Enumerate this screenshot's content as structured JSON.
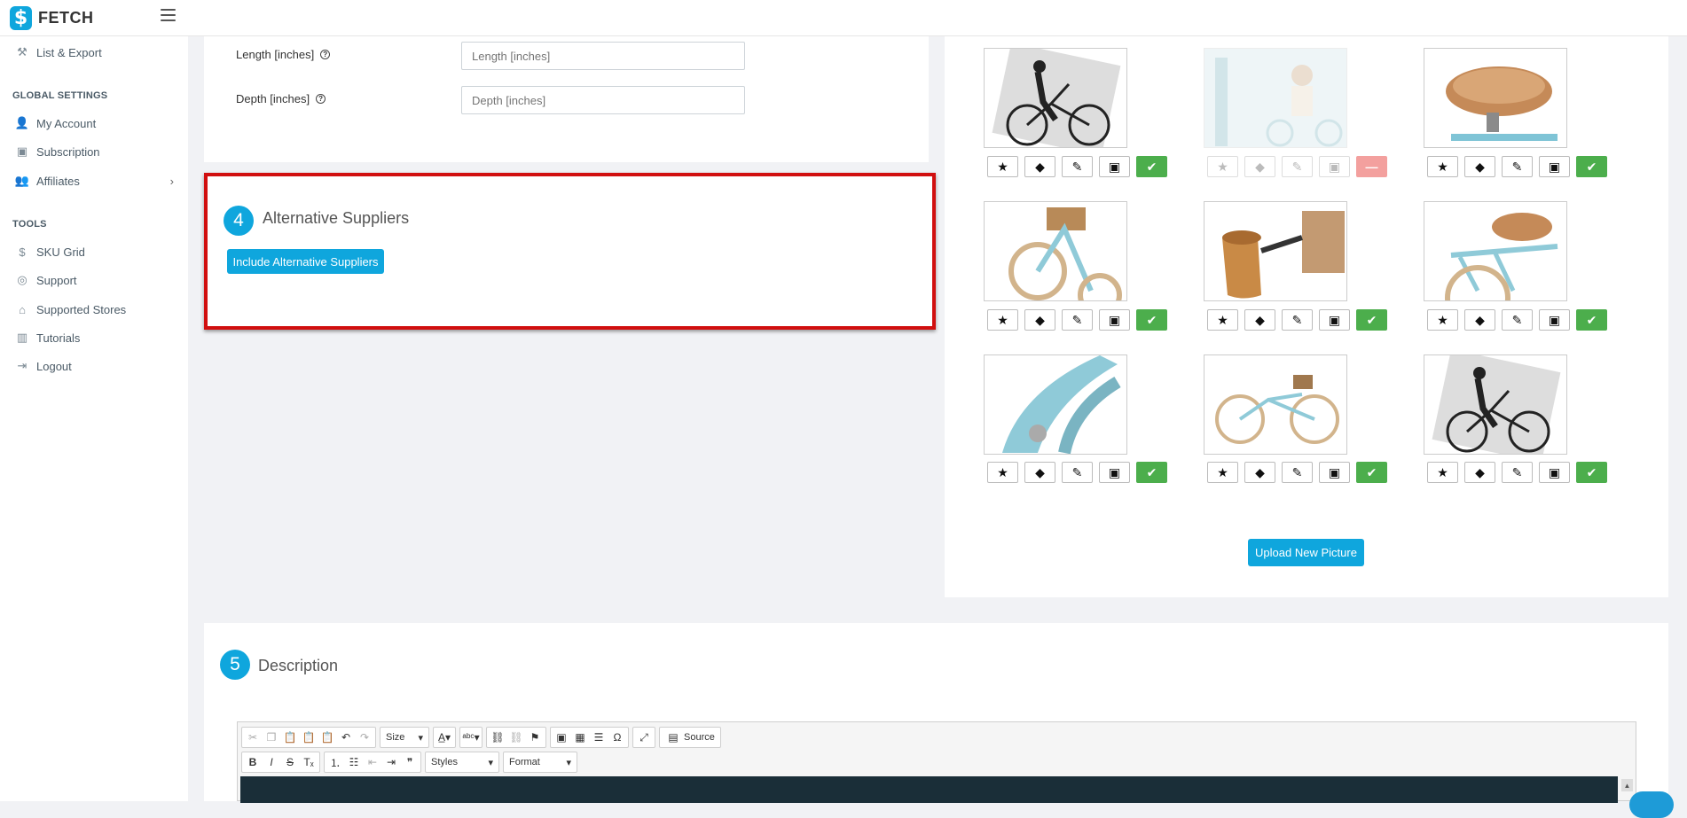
{
  "app": {
    "name": "FETCH",
    "logo_letter": "$"
  },
  "sidebar": {
    "top_item": {
      "label": "List & Export",
      "icon": "wrench-icon"
    },
    "sections": [
      {
        "heading": "GLOBAL SETTINGS",
        "items": [
          {
            "label": "My Account",
            "icon": "user-icon"
          },
          {
            "label": "Subscription",
            "icon": "card-icon"
          },
          {
            "label": "Affiliates",
            "icon": "user-plus-icon",
            "chevron": "›"
          }
        ]
      },
      {
        "heading": "TOOLS",
        "items": [
          {
            "label": "SKU Grid",
            "icon": "dollar-logo-icon"
          },
          {
            "label": "Support",
            "icon": "lifebuoy-icon"
          },
          {
            "label": "Supported Stores",
            "icon": "store-icon"
          },
          {
            "label": "Tutorials",
            "icon": "books-icon"
          },
          {
            "label": "Logout",
            "icon": "logout-icon"
          }
        ]
      }
    ]
  },
  "dimensions": {
    "length": {
      "label": "Length [inches]",
      "placeholder": "Length [inches]",
      "help": "?"
    },
    "depth": {
      "label": "Depth [inches]",
      "placeholder": "Depth [inches]",
      "help": "?"
    }
  },
  "alt_suppliers": {
    "step": "4",
    "title": "Alternative Suppliers",
    "button": "Include Alternative Suppliers"
  },
  "pictures": {
    "upload_button": "Upload New Picture",
    "items": [
      {
        "subject": "rider-diagram",
        "status": "active"
      },
      {
        "subject": "woman-riding",
        "status": "removed"
      },
      {
        "subject": "saddle",
        "status": "active"
      },
      {
        "subject": "basket-front",
        "status": "active"
      },
      {
        "subject": "cup-holder",
        "status": "active"
      },
      {
        "subject": "rear-rack",
        "status": "active"
      },
      {
        "subject": "fender-closeup",
        "status": "active"
      },
      {
        "subject": "full-bike",
        "status": "active"
      },
      {
        "subject": "rider-diagram-2",
        "status": "active"
      }
    ]
  },
  "description": {
    "step": "5",
    "title": "Description",
    "toolbar": {
      "size_label": "Size",
      "styles_label": "Styles",
      "format_label": "Format",
      "source_label": "Source"
    }
  },
  "colors": {
    "accent": "#0fa6dd",
    "highlight": "#d10f0f",
    "success": "#4cae4c",
    "danger_light": "#f3a09e"
  }
}
